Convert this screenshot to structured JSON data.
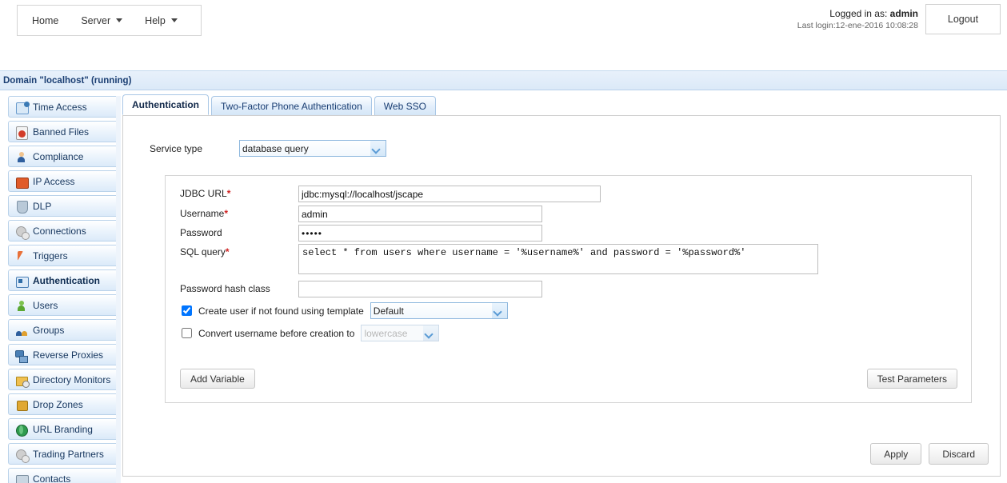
{
  "topnav": {
    "items": [
      {
        "label": "Home",
        "has_caret": false
      },
      {
        "label": "Server",
        "has_caret": true
      },
      {
        "label": "Help",
        "has_caret": true
      }
    ],
    "logged_in_prefix": "Logged in as: ",
    "logged_in_user": "admin",
    "last_login": "Last login:12-ene-2016 10:08:28",
    "logout_label": "Logout"
  },
  "domain_bar": {
    "text": "Domain \"localhost\" (running)"
  },
  "sidebar": {
    "items": [
      {
        "label": "Time Access",
        "icon": "clock-icon",
        "selected": false
      },
      {
        "label": "Banned Files",
        "icon": "banned-file-icon",
        "selected": false
      },
      {
        "label": "Compliance",
        "icon": "person-icon",
        "selected": false
      },
      {
        "label": "IP Access",
        "icon": "brick-wall-icon",
        "selected": false
      },
      {
        "label": "DLP",
        "icon": "shield-icon",
        "selected": false
      },
      {
        "label": "Connections",
        "icon": "gears-icon",
        "selected": false
      },
      {
        "label": "Triggers",
        "icon": "lightning-icon",
        "selected": false
      },
      {
        "label": "Authentication",
        "icon": "authentication-icon",
        "selected": true
      },
      {
        "label": "Users",
        "icon": "user-icon",
        "selected": false
      },
      {
        "label": "Groups",
        "icon": "group-icon",
        "selected": false
      },
      {
        "label": "Reverse Proxies",
        "icon": "proxy-icon",
        "selected": false
      },
      {
        "label": "Directory Monitors",
        "icon": "folder-clock-icon",
        "selected": false
      },
      {
        "label": "Drop Zones",
        "icon": "box-icon",
        "selected": false
      },
      {
        "label": "URL Branding",
        "icon": "globe-icon",
        "selected": false
      },
      {
        "label": "Trading Partners",
        "icon": "gears-icon",
        "selected": false
      },
      {
        "label": "Contacts",
        "icon": "contacts-icon",
        "selected": false
      }
    ]
  },
  "tabs": [
    {
      "label": "Authentication",
      "active": true
    },
    {
      "label": "Two-Factor Phone Authentication",
      "active": false
    },
    {
      "label": "Web SSO",
      "active": false
    }
  ],
  "form": {
    "service_type_label": "Service type",
    "service_type_value": "database query",
    "fields": {
      "jdbc_url_label": "JDBC URL",
      "jdbc_url_value": "jdbc:mysql://localhost/jscape",
      "username_label": "Username",
      "username_value": "admin",
      "password_label": "Password",
      "password_value": "•••••",
      "sql_query_label": "SQL query",
      "sql_query_value": "select * from users where username = '%username%' and password = '%password%'",
      "password_hash_label": "Password hash class",
      "password_hash_value": ""
    },
    "required_marker": "*",
    "checkboxes": {
      "create_user_label": "Create user if not found using template",
      "create_user_checked": true,
      "create_user_template_value": "Default",
      "convert_username_label": "Convert username before creation to",
      "convert_username_checked": false,
      "convert_username_value": "lowercase"
    },
    "buttons": {
      "add_variable": "Add Variable",
      "test_parameters": "Test Parameters",
      "apply": "Apply",
      "discard": "Discard"
    }
  },
  "colors": {
    "accent_blue": "#1b3f73",
    "panel_border": "#cfcfcf",
    "required_red": "#d02020",
    "domain_bar_bg": "#e2edf9"
  }
}
